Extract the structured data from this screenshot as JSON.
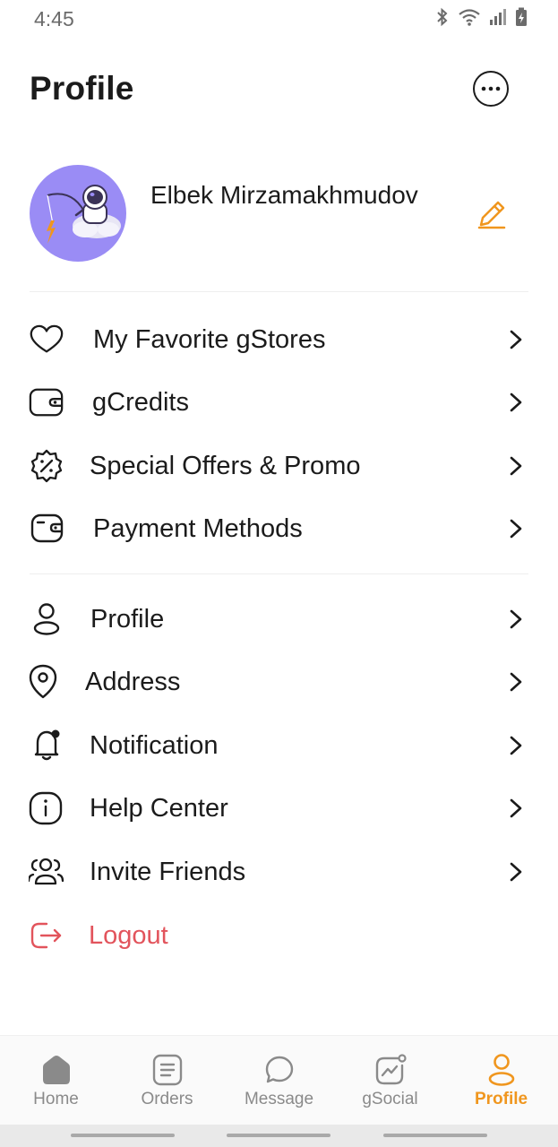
{
  "status_bar": {
    "time": "4:45"
  },
  "header": {
    "title": "Profile"
  },
  "user": {
    "name": "Elbek Mirzamakhmudov"
  },
  "menu_group_1": [
    {
      "label": "My Favorite gStores",
      "icon": "heart-icon"
    },
    {
      "label": "gCredits",
      "icon": "wallet-icon"
    },
    {
      "label": "Special Offers & Promo",
      "icon": "discount-badge-icon"
    },
    {
      "label": "Payment Methods",
      "icon": "wallet-icon"
    }
  ],
  "menu_group_2": [
    {
      "label": "Profile",
      "icon": "user-icon"
    },
    {
      "label": "Address",
      "icon": "location-pin-icon"
    },
    {
      "label": "Notification",
      "icon": "bell-icon"
    },
    {
      "label": "Help Center",
      "icon": "info-icon"
    },
    {
      "label": "Invite Friends",
      "icon": "users-icon"
    }
  ],
  "logout": {
    "label": "Logout",
    "icon": "logout-icon",
    "color": "#e2545c"
  },
  "bottom_nav": [
    {
      "label": "Home",
      "icon": "home-icon",
      "active": false
    },
    {
      "label": "Orders",
      "icon": "orders-icon",
      "active": false
    },
    {
      "label": "Message",
      "icon": "chat-bubble-icon",
      "active": false
    },
    {
      "label": "gSocial",
      "icon": "chart-icon",
      "active": false
    },
    {
      "label": "Profile",
      "icon": "user-icon",
      "active": true
    }
  ],
  "colors": {
    "accent": "#f0961e",
    "text": "#1b1b1b",
    "danger": "#e2545c",
    "avatar_bg": "#9a8cf5"
  }
}
